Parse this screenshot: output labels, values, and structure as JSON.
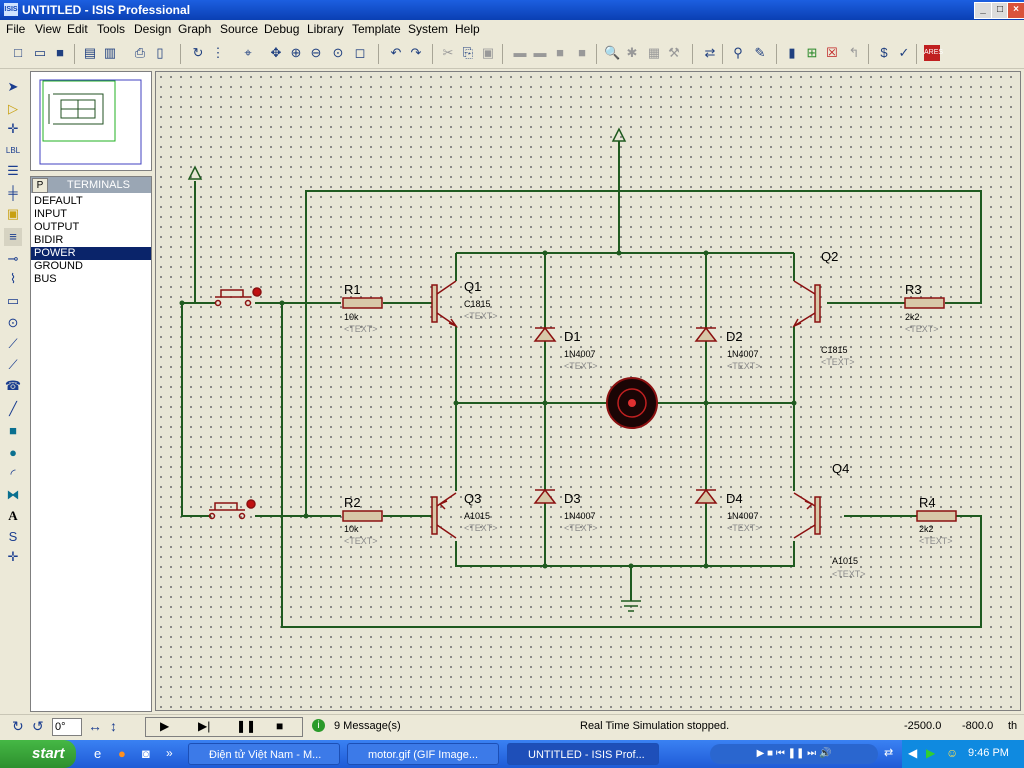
{
  "window": {
    "title": "UNTITLED - ISIS Professional",
    "icon_text": "ISIS"
  },
  "menu": [
    "File",
    "View",
    "Edit",
    "Tools",
    "Design",
    "Graph",
    "Source",
    "Debug",
    "Library",
    "Template",
    "System",
    "Help"
  ],
  "picker": {
    "mode_button": "P",
    "title": "TERMINALS",
    "items": [
      "DEFAULT",
      "INPUT",
      "OUTPUT",
      "BIDIR",
      "POWER",
      "GROUND",
      "BUS"
    ],
    "selected": "POWER"
  },
  "schematic": {
    "components": [
      {
        "ref": "R1",
        "value": "10k",
        "text": "<TEXT>"
      },
      {
        "ref": "R2",
        "value": "10k",
        "text": "<TEXT>"
      },
      {
        "ref": "R3",
        "value": "2k2",
        "text": "<TEXT>"
      },
      {
        "ref": "R4",
        "value": "2k2",
        "text": "<TEXT>"
      },
      {
        "ref": "Q1",
        "value": "C1815",
        "text": "<TEXT>"
      },
      {
        "ref": "Q2",
        "value": "C1815",
        "text": "<TEXT>"
      },
      {
        "ref": "Q3",
        "value": "A1015",
        "text": "<TEXT>"
      },
      {
        "ref": "Q4",
        "value": "A1015",
        "text": "<TEXT>"
      },
      {
        "ref": "D1",
        "value": "1N4007",
        "text": "<TEXT>"
      },
      {
        "ref": "D2",
        "value": "1N4007",
        "text": "<TEXT>"
      },
      {
        "ref": "D3",
        "value": "1N4007",
        "text": "<TEXT>"
      },
      {
        "ref": "D4",
        "value": "1N4007",
        "text": "<TEXT>"
      }
    ]
  },
  "status": {
    "rotation": "0°",
    "messages": "9 Message(s)",
    "sim_status": "Real Time Simulation stopped.",
    "coord_x": "-2500.0",
    "coord_y": "-800.0",
    "unit": "th"
  },
  "taskbar": {
    "start": "start",
    "tasks": [
      "Điện tử Việt Nam - M...",
      "motor.gif (GIF Image...",
      "UNTITLED - ISIS Prof..."
    ],
    "clock": "9:46 PM"
  },
  "colors": {
    "wire": "#1f5a1f",
    "component": "#8b1010",
    "component_fill": "#d8c8a8",
    "canvas": "#e8e6d6",
    "titlebar": "#0a3fb3"
  }
}
